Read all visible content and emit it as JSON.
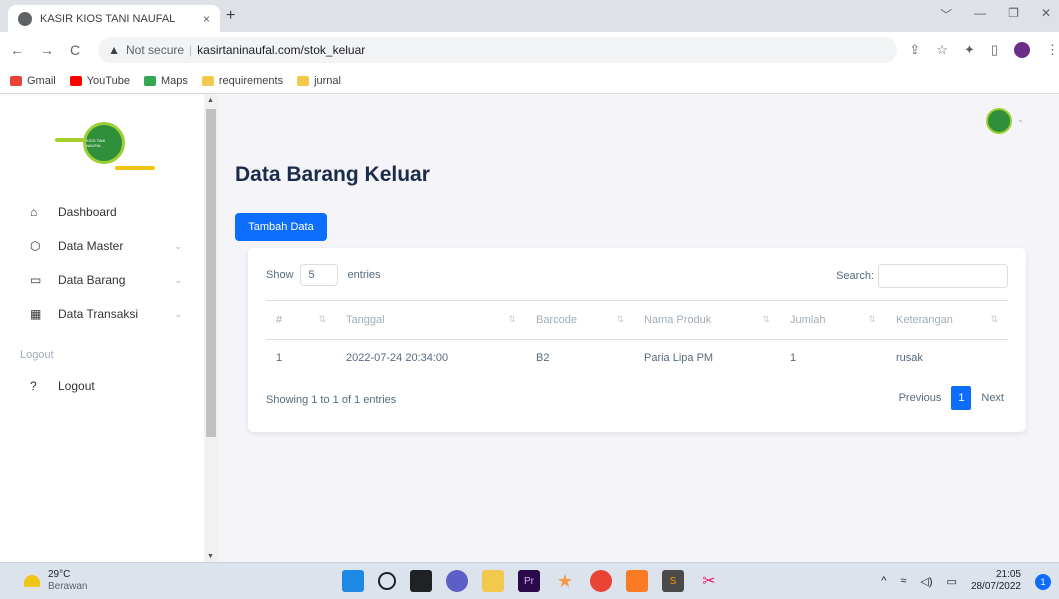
{
  "browser": {
    "tab_title": "KASIR KIOS TANI NAUFAL",
    "tab_close": "×",
    "new_tab": "+",
    "window_controls": [
      "﹀",
      "—",
      "❐",
      "✕"
    ],
    "nav": {
      "back": "←",
      "forward": "→",
      "reload": "C"
    },
    "security_icon": "▲",
    "security_label": "Not secure",
    "separator": "|",
    "url": "kasirtaninaufal.com/stok_keluar",
    "addr_icons": {
      "share": "⇪",
      "star": "☆",
      "extensions": "✦",
      "sidepanel": "▯"
    },
    "menu": "⋮",
    "bookmarks": [
      {
        "label": "Gmail",
        "color": "#ea4335"
      },
      {
        "label": "YouTube",
        "color": "#ff0000"
      },
      {
        "label": "Maps",
        "color": "#34a853"
      },
      {
        "label": "requirements",
        "color": "#f2c94c"
      },
      {
        "label": "jurnal",
        "color": "#f2c94c"
      }
    ]
  },
  "sidebar": {
    "logo_text": "KIOS TANI NAUFAL",
    "items": [
      {
        "label": "Dashboard",
        "icon": "home-icon",
        "glyph": "⌂"
      },
      {
        "label": "Data Master",
        "icon": "cube-icon",
        "glyph": "⬡",
        "chevron": "⌄"
      },
      {
        "label": "Data Barang",
        "icon": "window-icon",
        "glyph": "▭",
        "chevron": "⌄"
      },
      {
        "label": "Data Transaksi",
        "icon": "grid-icon",
        "glyph": "▦",
        "chevron": "⌄"
      }
    ],
    "section_header": "Logout",
    "logout": {
      "label": "Logout",
      "icon": "help-icon",
      "glyph": "?"
    },
    "scroll_up": "▲",
    "scroll_down": "▼"
  },
  "header": {
    "avatar_chevron": "⌄"
  },
  "main": {
    "title": "Data Barang Keluar",
    "add_button": "Tambah Data",
    "show_label": "Show",
    "entries_value": "5",
    "entries_label": "entries",
    "search_label": "Search:",
    "search_value": "",
    "sort_glyph": "⇅",
    "columns": [
      "#",
      "Tanggal",
      "Barcode",
      "Nama Produk",
      "Jumlah",
      "Keterangan"
    ],
    "rows": [
      [
        "1",
        "2022-07-24 20:34:00",
        "B2",
        "Paria Lipa PM",
        "1",
        "rusak"
      ]
    ],
    "info": "Showing 1 to 1 of 1 entries",
    "pagination": {
      "previous": "Previous",
      "current": "1",
      "next": "Next"
    }
  },
  "taskbar": {
    "temperature": "29°C",
    "weather": "Berawan",
    "apps": [
      {
        "name": "windows-start-icon",
        "color": "#1e88e5",
        "glyph": ""
      },
      {
        "name": "search-icon",
        "color": "#dce3ec",
        "glyph": ""
      },
      {
        "name": "task-view-icon",
        "color": "#202124",
        "glyph": ""
      },
      {
        "name": "chat-icon",
        "color": "#5b5fc7",
        "glyph": ""
      },
      {
        "name": "file-explorer-icon",
        "color": "#f2c94c",
        "glyph": ""
      },
      {
        "name": "premiere-icon",
        "color": "#2a0a4a",
        "glyph": "Pr"
      },
      {
        "name": "star-app-icon",
        "color": "#dce3ec",
        "glyph": "★"
      },
      {
        "name": "chrome-icon",
        "color": "#ea4335",
        "glyph": ""
      },
      {
        "name": "xampp-icon",
        "color": "#fb7a24",
        "glyph": ""
      },
      {
        "name": "sublime-icon",
        "color": "#4a4a4a",
        "glyph": "S"
      },
      {
        "name": "snipping-icon",
        "color": "#dce3ec",
        "glyph": "✂"
      }
    ],
    "tray": {
      "caret": "^",
      "wifi": "≈",
      "volume": "◁)",
      "battery": "▭"
    },
    "time": "21:05",
    "date": "28/07/2022",
    "notifications": "1"
  }
}
